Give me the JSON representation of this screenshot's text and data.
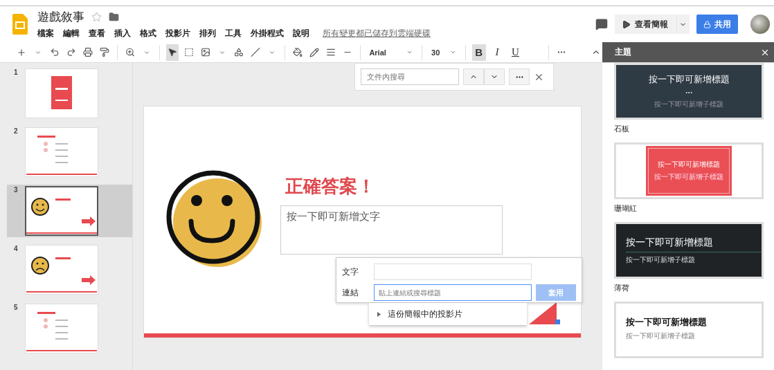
{
  "app": {
    "title": "遊戲敘事",
    "starred": false
  },
  "menu": [
    "檔案",
    "編輯",
    "查看",
    "插入",
    "格式",
    "投影片",
    "排列",
    "工具",
    "外掛程式",
    "說明"
  ],
  "save_status": "所有變更都已儲存到雲端硬碟",
  "header_buttons": {
    "present": "查看簡報",
    "share": "共用"
  },
  "toolbar": {
    "font": "Arial",
    "size": "30",
    "format": [
      {
        "kind": "bold",
        "label": "B",
        "selected": true
      },
      {
        "kind": "italic",
        "label": "I",
        "selected": false
      },
      {
        "kind": "underline",
        "label": "U",
        "selected": false
      }
    ]
  },
  "search": {
    "placeholder": "文件內搜尋"
  },
  "slides": [
    {
      "number": "1",
      "selected": false,
      "kind": "title"
    },
    {
      "number": "2",
      "selected": false,
      "kind": "quiz"
    },
    {
      "number": "3",
      "selected": true,
      "kind": "correct"
    },
    {
      "number": "4",
      "selected": false,
      "kind": "wrong"
    },
    {
      "number": "5",
      "selected": false,
      "kind": "quiz"
    }
  ],
  "slide": {
    "title": "正確答案！",
    "body_placeholder": "按一下即可新增文字"
  },
  "link_dialog": {
    "text_label": "文字",
    "link_label": "連結",
    "link_placeholder": "貼上連結或搜尋標題",
    "apply": "套用",
    "suggestion": "這份簡報中的投影片"
  },
  "theme_panel": {
    "title": "主題",
    "themes": [
      {
        "name": "石板",
        "kind": "slate",
        "title": "按一下即可新增標題",
        "subtitle": "按一下即可新增子標題"
      },
      {
        "name": "珊瑚紅",
        "kind": "coral",
        "title": "按一下即可新增標題",
        "subtitle": "按一下即可新增子標題"
      },
      {
        "name": "薄荷",
        "kind": "mint",
        "title": "按一下即可新增標題",
        "subtitle": "按一下即可新增子標題"
      },
      {
        "kind": "plain",
        "title": "按一下即可新增標題",
        "subtitle": "按一下即可新增子標題"
      }
    ]
  }
}
